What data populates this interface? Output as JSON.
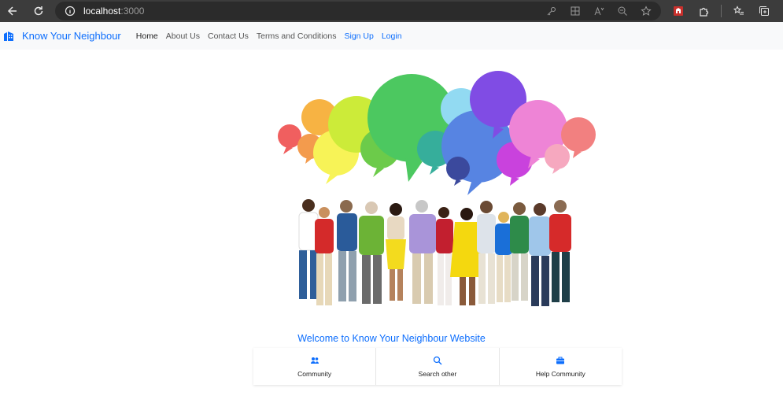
{
  "browser": {
    "url_host": "localhost",
    "url_port": ":3000",
    "icons": [
      "back-icon",
      "reload-icon",
      "info-icon",
      "key-icon",
      "grid-icon",
      "read-aloud-icon",
      "zoom-icon",
      "favorite-icon",
      "extension-red-icon",
      "extensions-icon",
      "favorites-bar-icon",
      "collections-icon"
    ]
  },
  "navbar": {
    "brand": "Know Your Neighbour",
    "links": {
      "home": "Home",
      "about": "About Us",
      "contact": "Contact Us",
      "terms": "Terms and Conditions",
      "signup": "Sign Up",
      "login": "Login"
    }
  },
  "hero": {
    "heading": "Welcome to Know Your Neighbour Website"
  },
  "features": {
    "community": "Community",
    "search": "Search other",
    "help": "Help Community"
  },
  "colors": {
    "brand_blue": "#0d6efd",
    "navbar_bg": "#f8f9fa"
  }
}
